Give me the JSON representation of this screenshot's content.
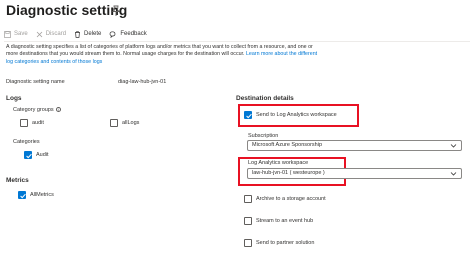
{
  "page": {
    "title": "Diagnostic setting"
  },
  "toolbar": {
    "save": "Save",
    "discard": "Discard",
    "delete": "Delete",
    "feedback": "Feedback"
  },
  "description": {
    "text": "A diagnostic setting specifies a list of categories of platform logs and/or metrics that you want to collect from a resource, and one or more destinations that you would stream them to. Normal usage charges for the destination will occur.",
    "link": "Learn more about the different log categories and contents of those logs"
  },
  "setting_name": {
    "label": "Diagnostic setting name",
    "value": "diag-law-hub-jvn-01"
  },
  "logs": {
    "heading": "Logs",
    "category_groups_label": "Category groups",
    "groups": [
      {
        "label": "audit",
        "checked": false
      },
      {
        "label": "allLogs",
        "checked": false
      }
    ],
    "categories_label": "Categories",
    "categories": [
      {
        "label": "Audit",
        "checked": true
      }
    ]
  },
  "metrics": {
    "heading": "Metrics",
    "items": [
      {
        "label": "AllMetrics",
        "checked": true
      }
    ]
  },
  "destination": {
    "heading": "Destination details",
    "log_analytics": {
      "label": "Send to Log Analytics workspace",
      "checked": true
    },
    "subscription": {
      "label": "Subscription",
      "value": "Microsoft Azure Sponsorship"
    },
    "workspace": {
      "label": "Log Analytics workspace",
      "value": "law-hub-jvn-01 ( westeurope )"
    },
    "archive": {
      "label": "Archive to a storage account",
      "checked": false
    },
    "event_hub": {
      "label": "Stream to an event hub",
      "checked": false
    },
    "partner": {
      "label": "Send to partner solution",
      "checked": false
    }
  },
  "colors": {
    "accent": "#0078d4",
    "highlight": "#e81123",
    "disabled": "#a19f9d"
  },
  "icons": [
    "pin-icon",
    "save-icon",
    "discard-icon",
    "delete-icon",
    "feedback-icon",
    "info-icon",
    "chevron-down-icon",
    "checkmark-icon"
  ]
}
